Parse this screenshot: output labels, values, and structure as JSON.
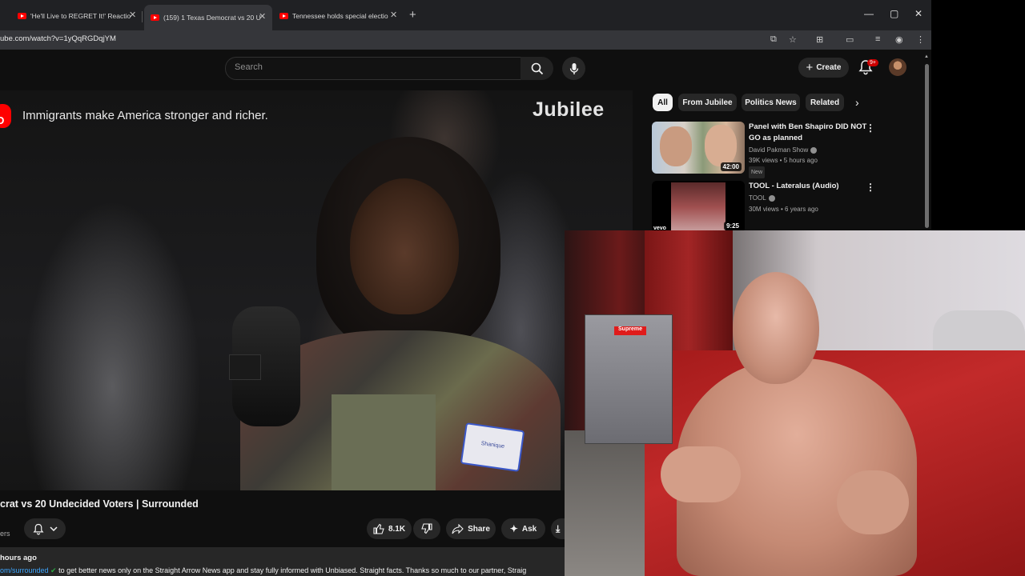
{
  "browser": {
    "tabs": [
      {
        "label": "'He'll Live to REGRET It!' Reactio"
      },
      {
        "label": "(159) 1 Texas Democrat vs 20 U"
      },
      {
        "label": "Tennessee holds special electio"
      }
    ],
    "new_tab_symbol": "+",
    "controls": {
      "minimize": "—",
      "maximize": "▢",
      "close": "✕"
    },
    "url": "ube.com/watch?v=1yQqRGDqjYM"
  },
  "youtube": {
    "search": {
      "placeholder": "Search"
    },
    "create_label": "Create",
    "notifications_badge": "9+"
  },
  "player": {
    "caption": "Immigrants make America stronger and richer.",
    "channel_watermark": "Jubilee",
    "nametag": "Shanique"
  },
  "video": {
    "title": "crat vs 20 Undecided Voters | Surrounded",
    "subscribers_fragment": "ers",
    "likes": "8.1K",
    "share_label": "Share",
    "ask_label": "Ask",
    "upload_time": "hours ago",
    "description_link": "om/surrounded",
    "description_text": " to get better news only on the Straight Arrow News app and stay fully informed with Unbiased. Straight facts. Thanks so much to our partner, Straig"
  },
  "sidebar": {
    "chips": [
      {
        "label": "All"
      },
      {
        "label": "From Jubilee"
      },
      {
        "label": "Politics News"
      },
      {
        "label": "Related"
      }
    ],
    "videos": [
      {
        "title": "Panel with Ben Shapiro DID NOT GO as planned",
        "channel": "David Pakman Show",
        "stats": "39K views • 5 hours ago",
        "badge": "New",
        "duration": "42:00"
      },
      {
        "title": "TOOL - Lateralus (Audio)",
        "channel": "TOOL",
        "stats": "30M views • 6 years ago",
        "duration": "9:25",
        "thumb_label": "vevo"
      }
    ]
  },
  "webcam": {
    "sticker": "Supreme"
  }
}
